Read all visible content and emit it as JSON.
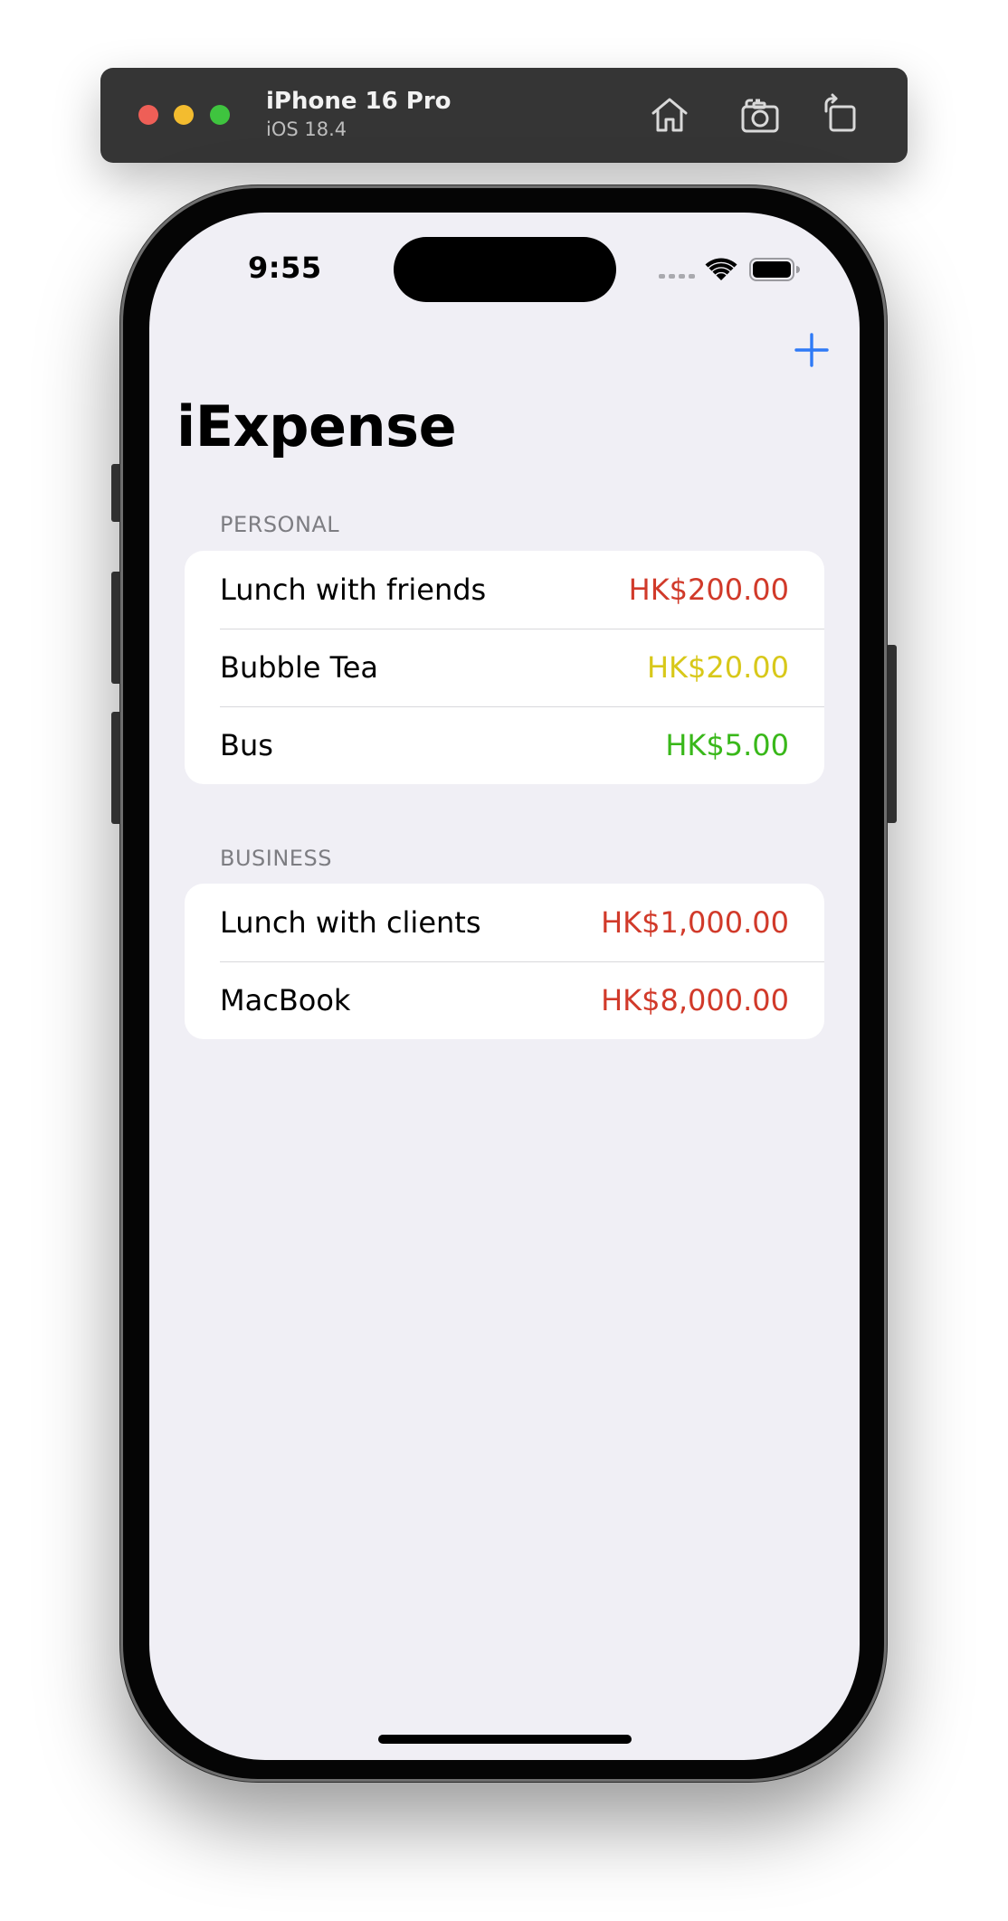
{
  "simulator": {
    "device_name": "iPhone 16 Pro",
    "os_version": "iOS 18.4",
    "icons": [
      "home-icon",
      "screenshot-icon",
      "rotate-icon"
    ]
  },
  "status_bar": {
    "time": "9:55",
    "icons": [
      "cellular-signal-icon",
      "wifi-icon",
      "battery-icon"
    ]
  },
  "nav": {
    "add_icon": "plus-icon",
    "title": "iExpense"
  },
  "sections": [
    {
      "header": "PERSONAL",
      "items": [
        {
          "name": "Lunch with friends",
          "amount": "HK$200.00",
          "color": "#d13a2a"
        },
        {
          "name": "Bubble Tea",
          "amount": "HK$20.00",
          "color": "#d8c81a"
        },
        {
          "name": "Bus",
          "amount": "HK$5.00",
          "color": "#39b81a"
        }
      ]
    },
    {
      "header": "BUSINESS",
      "items": [
        {
          "name": "Lunch with clients",
          "amount": "HK$1,000.00",
          "color": "#d13a2a"
        },
        {
          "name": "MacBook",
          "amount": "HK$8,000.00",
          "color": "#d13a2a"
        }
      ]
    }
  ],
  "colors": {
    "accent": "#2f7af6",
    "background": "#f0eff5",
    "card": "#ffffff"
  }
}
